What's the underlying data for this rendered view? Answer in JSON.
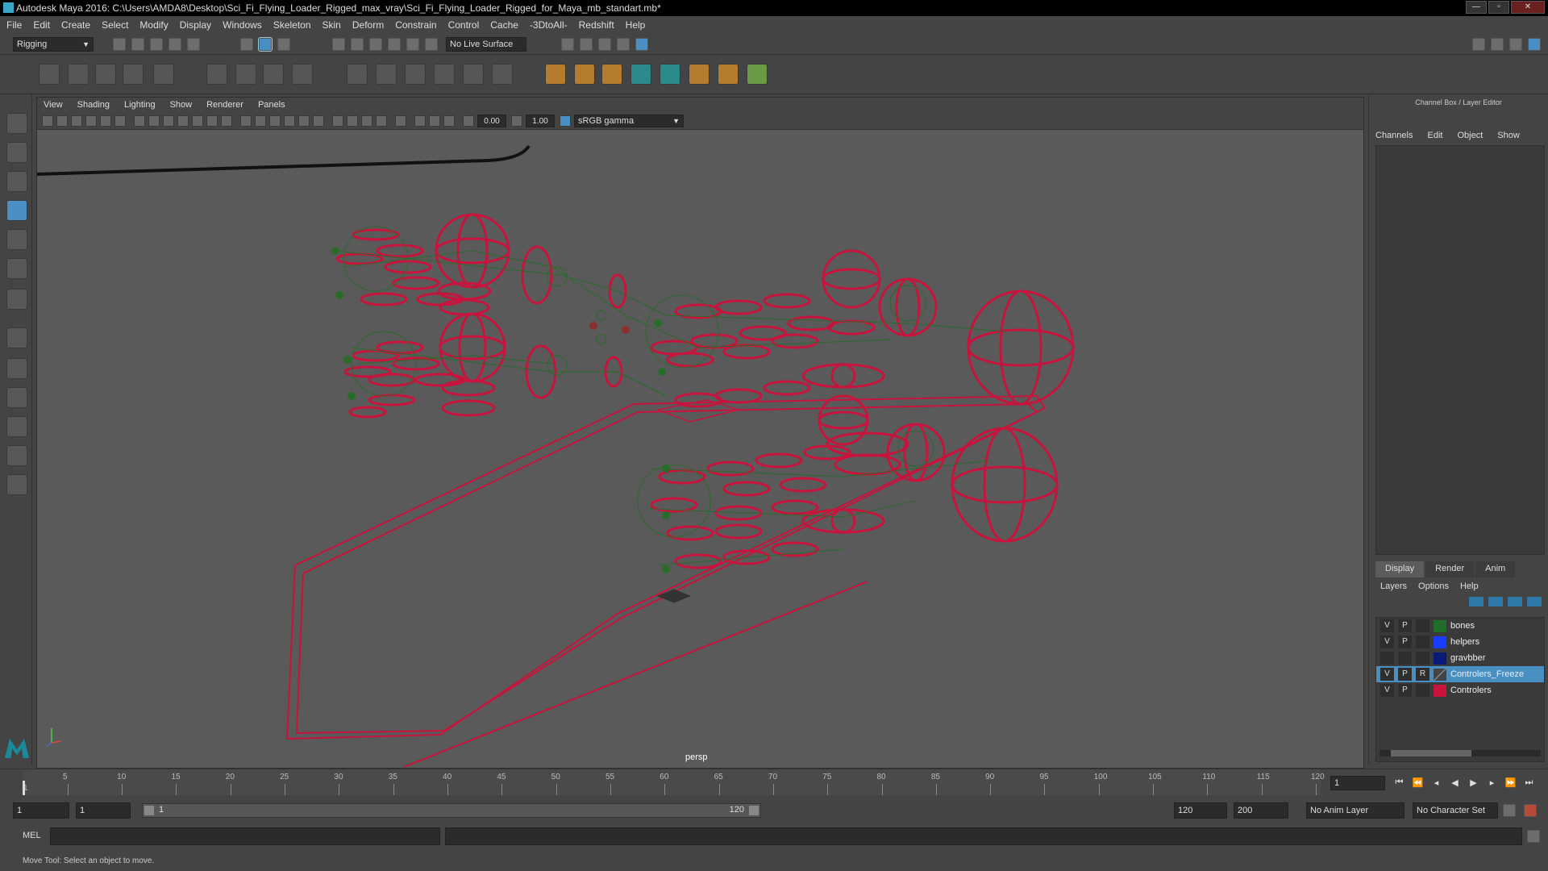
{
  "window": {
    "title": "Autodesk Maya 2016: C:\\Users\\AMDA8\\Desktop\\Sci_Fi_Flying_Loader_Rigged_max_vray\\Sci_Fi_Flying_Loader_Rigged_for_Maya_mb_standart.mb*"
  },
  "menubar": {
    "items": [
      "File",
      "Edit",
      "Create",
      "Select",
      "Modify",
      "Display",
      "Windows",
      "Skeleton",
      "Skin",
      "Deform",
      "Constrain",
      "Control",
      "Cache",
      "-3DtoAll-",
      "Redshift",
      "Help"
    ]
  },
  "statusline": {
    "mode": "Rigging",
    "live_surface": "No Live Surface"
  },
  "viewport": {
    "menu": [
      "View",
      "Shading",
      "Lighting",
      "Show",
      "Renderer",
      "Panels"
    ],
    "exposure": "0.00",
    "gamma_value": "1.00",
    "color_space": "sRGB gamma",
    "camera_label": "persp"
  },
  "channel_box": {
    "title": "Channel Box / Layer Editor",
    "tabs": [
      "Channels",
      "Edit",
      "Object",
      "Show"
    ]
  },
  "layer_editor": {
    "tabs": [
      "Display",
      "Render",
      "Anim"
    ],
    "active_tab": "Display",
    "menu": [
      "Layers",
      "Options",
      "Help"
    ],
    "layers": [
      {
        "v": "V",
        "p": "P",
        "r": "",
        "name": "bones",
        "color": "#1f6e2a",
        "selected": false
      },
      {
        "v": "V",
        "p": "P",
        "r": "",
        "name": "helpers",
        "color": "#1a3cff",
        "selected": false
      },
      {
        "v": "",
        "p": "",
        "r": "",
        "name": "gravbber",
        "color": "#0a1a78",
        "selected": false
      },
      {
        "v": "V",
        "p": "P",
        "r": "R",
        "name": "Controlers_Freeze",
        "color": "#444444",
        "selected": true
      },
      {
        "v": "V",
        "p": "P",
        "r": "",
        "name": "Controlers",
        "color": "#c8143c",
        "selected": false
      }
    ]
  },
  "timeline": {
    "ticks": [
      "5",
      "10",
      "15",
      "20",
      "25",
      "30",
      "35",
      "40",
      "45",
      "50",
      "55",
      "60",
      "65",
      "70",
      "75",
      "80",
      "85",
      "90",
      "95",
      "100",
      "105",
      "110",
      "115",
      "120"
    ],
    "cursor_label": "1",
    "current_frame": "1"
  },
  "range": {
    "start": "1",
    "playback_start": "1",
    "slider_start": "1",
    "slider_end": "120",
    "playback_end": "120",
    "end": "200",
    "anim_layer": "No Anim Layer",
    "char_set": "No Character Set"
  },
  "command": {
    "label": "MEL"
  },
  "help_line": "Move Tool: Select an object to move.",
  "colors": {
    "rig_red": "#c8143c",
    "bone_green": "#2a6b2a",
    "selection_blue": "#4a8fc4"
  }
}
